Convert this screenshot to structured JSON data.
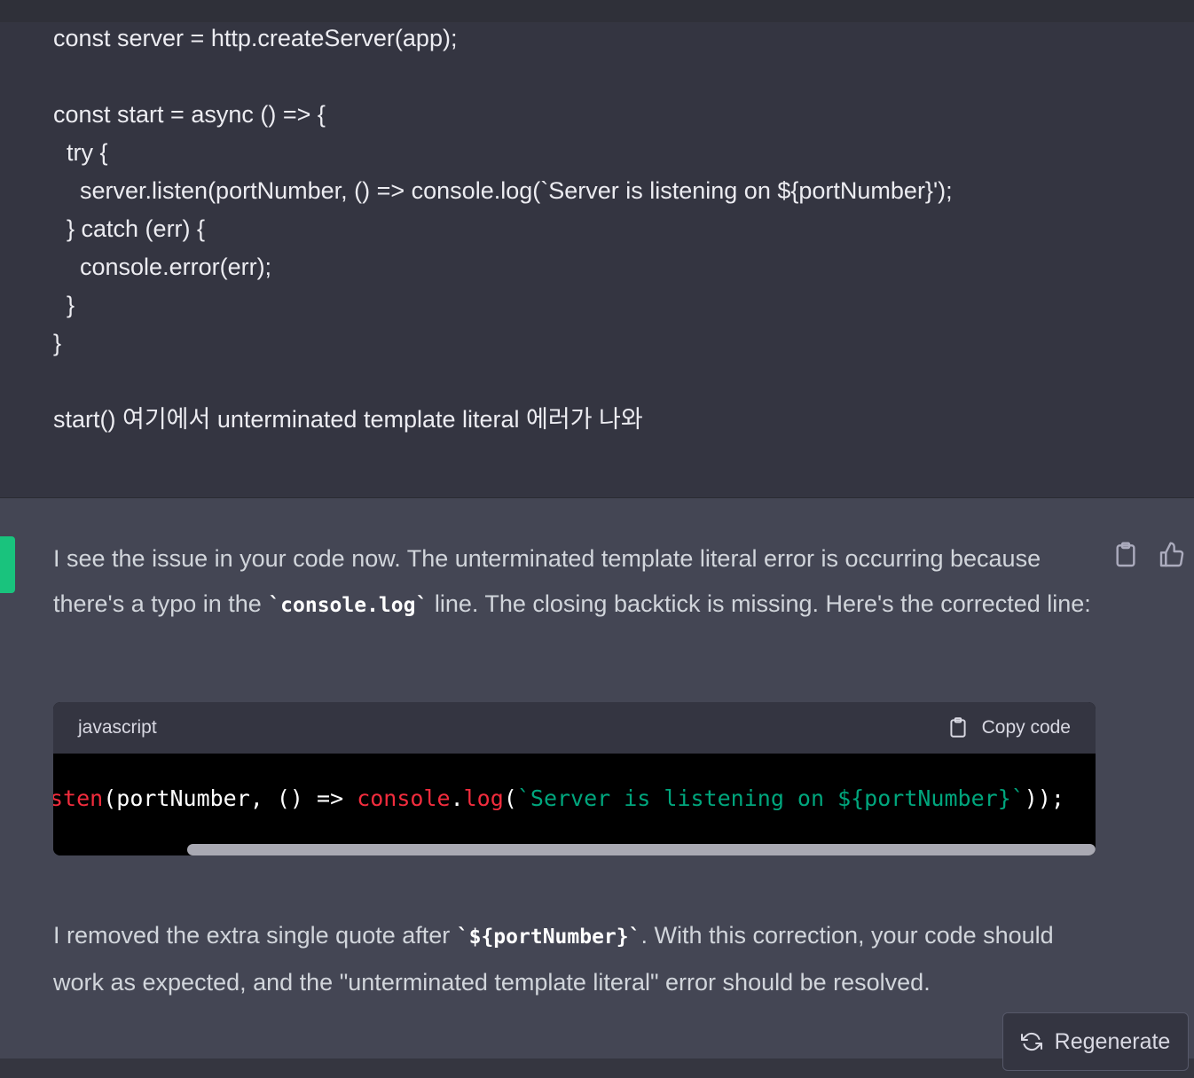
{
  "user_message": {
    "lines": [
      "const server = http.createServer(app);",
      "",
      "const start = async () => {",
      "  try {",
      "    server.listen(portNumber, () => console.log(`Server is listening on ${portNumber}');",
      "  } catch (err) {",
      "    console.error(err);",
      "  }",
      "}",
      "",
      "start() 여기에서 unterminated template literal 에러가 나와"
    ]
  },
  "assistant_message": {
    "para1": {
      "part1": "I see the issue in your code now. The unterminated template literal error is occurring because there's a typo in the ",
      "code": "`console.log`",
      "part2": " line. The closing backtick is missing. Here's the corrected line:"
    },
    "code_block": {
      "language": "javascript",
      "copy_label": "Copy code",
      "tokens": {
        "t1": "sten",
        "t2": "(portNumber, () => ",
        "t3": "console",
        "t4": ".",
        "t5": "log",
        "t6": "(",
        "t7": "`Server is listening on ${portNumber}`",
        "t8": "));"
      }
    },
    "para2": {
      "part1": "I removed the extra single quote after ",
      "code": "`${portNumber}`",
      "part2": ". With this correction, your code should work as expected, and the \"unterminated template literal\" error should be resolved."
    }
  },
  "regenerate_label": "Regenerate",
  "icons": {
    "copy_message": "clipboard-icon",
    "thumbs_up": "thumbs-up-icon",
    "copy_code": "clipboard-icon",
    "regenerate": "refresh-icon"
  },
  "colors": {
    "user_bg": "#343541",
    "assistant_bg": "#444654",
    "avatar": "#19c37d",
    "code_keyword": "#f22c3d",
    "code_string": "#00a67d"
  }
}
